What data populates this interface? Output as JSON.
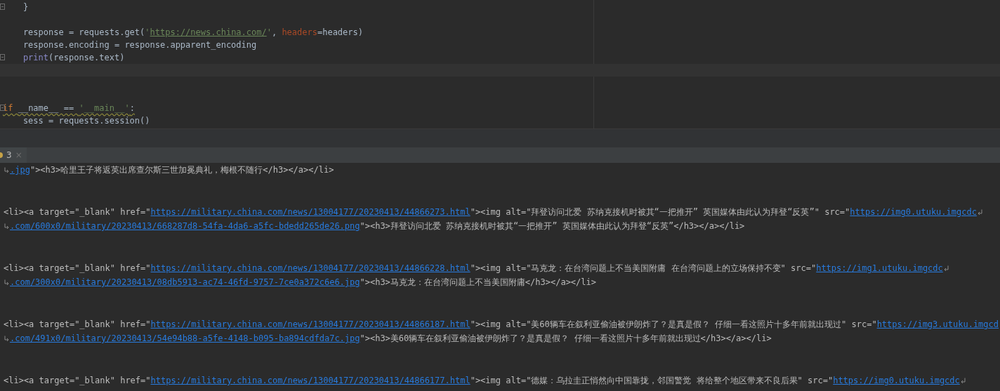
{
  "editor": {
    "lines": [
      {
        "kind": "code",
        "fold": true,
        "tokens": [
          {
            "kind": "plain",
            "text": "    }"
          }
        ]
      },
      {
        "kind": "blank"
      },
      {
        "kind": "code",
        "tokens": [
          {
            "kind": "plain",
            "text": "    response = requests.get("
          },
          {
            "kind": "string",
            "text": "'"
          },
          {
            "kind": "url",
            "text": "https://news.china.com/"
          },
          {
            "kind": "string",
            "text": "'"
          },
          {
            "kind": "plain",
            "text": ", "
          },
          {
            "kind": "param",
            "text": "headers"
          },
          {
            "kind": "plain",
            "text": "=headers)"
          }
        ]
      },
      {
        "kind": "code",
        "tokens": [
          {
            "kind": "plain",
            "text": "    response.encoding = response.apparent_encoding"
          }
        ]
      },
      {
        "kind": "code",
        "fold": true,
        "tokens": [
          {
            "kind": "builtin",
            "text": "    print"
          },
          {
            "kind": "plain",
            "text": "(response.text)"
          }
        ]
      },
      {
        "kind": "blank",
        "current": true
      },
      {
        "kind": "blank"
      },
      {
        "kind": "blank"
      },
      {
        "kind": "code",
        "fold": true,
        "warning": true,
        "tokens": [
          {
            "kind": "keyword",
            "text": "if "
          },
          {
            "kind": "plain",
            "text": "__name__ == "
          },
          {
            "kind": "string",
            "text": "'__main__'"
          },
          {
            "kind": "plain",
            "text": ":"
          }
        ]
      },
      {
        "kind": "code",
        "tokens": [
          {
            "kind": "plain",
            "text": "    sess = requests.session()"
          }
        ]
      }
    ]
  },
  "run_tabs": [
    {
      "label": "3",
      "close": "×",
      "selected": true
    }
  ],
  "console": {
    "records": [
      {
        "lines": [
          {
            "wrap_start": true,
            "segments": [
              {
                "kind": "link",
                "text": ".jpg"
              },
              {
                "kind": "text",
                "text": "\"><h3>哈里王子将返英出席查尔斯三世加冕典礼，梅根不随行</h3></a></li>"
              }
            ]
          }
        ]
      },
      {
        "lines": [
          {
            "wrap_end": true,
            "segments": [
              {
                "kind": "text",
                "text": "<li><a target=\"_blank\" href=\""
              },
              {
                "kind": "link",
                "text": "https://military.china.com/news/13004177/20230413/44866273.html"
              },
              {
                "kind": "text",
                "text": "\"><img alt=\"拜登访问北爱 苏纳克接机时被其“一把推开” 英国媒体由此认为拜登“反英”\" src=\""
              },
              {
                "kind": "link",
                "text": "https://img0.utuku.imgcdc"
              }
            ]
          },
          {
            "wrap_start": true,
            "segments": [
              {
                "kind": "link",
                "text": ".com/600x0/military/20230413/668287d8-54fa-4da6-a5fc-bdedd265de26.png"
              },
              {
                "kind": "text",
                "text": "\"><h3>拜登访问北爱 苏纳克接机时被其“一把推开” 英国媒体由此认为拜登“反英”</h3></a></li>"
              }
            ]
          }
        ]
      },
      {
        "lines": [
          {
            "wrap_end": true,
            "segments": [
              {
                "kind": "text",
                "text": "<li><a target=\"_blank\" href=\""
              },
              {
                "kind": "link",
                "text": "https://military.china.com/news/13004177/20230413/44866228.html"
              },
              {
                "kind": "text",
                "text": "\"><img alt=\"马克龙：在台湾问题上不当美国附庸 在台湾问题上的立场保持不变\" src=\""
              },
              {
                "kind": "link",
                "text": "https://img1.utuku.imgcdc"
              }
            ]
          },
          {
            "wrap_start": true,
            "segments": [
              {
                "kind": "link",
                "text": ".com/300x0/military/20230413/08db5913-ac74-46fd-9757-7ce0a372c6e6.jpg"
              },
              {
                "kind": "text",
                "text": "\"><h3>马克龙：在台湾问题上不当美国附庸</h3></a></li>"
              }
            ]
          }
        ]
      },
      {
        "lines": [
          {
            "segments": [
              {
                "kind": "text",
                "text": "<li><a target=\"_blank\" href=\""
              },
              {
                "kind": "link",
                "text": "https://military.china.com/news/13004177/20230413/44866187.html"
              },
              {
                "kind": "text",
                "text": "\"><img alt=\"美60辆车在叙利亚偷油被伊朗炸了？是真是假？ 仔细一看这照片十多年前就出现过\" src=\""
              },
              {
                "kind": "link",
                "text": "https://img3.utuku.imgcd"
              }
            ]
          },
          {
            "wrap_start": true,
            "segments": [
              {
                "kind": "link",
                "text": ".com/491x0/military/20230413/54e94b88-a5fe-4148-b095-ba894cdfda7c.jpg"
              },
              {
                "kind": "text",
                "text": "\"><h3>美60辆车在叙利亚偷油被伊朗炸了？是真是假？ 仔细一看这照片十多年前就出现过</h3></a></li>"
              }
            ]
          }
        ]
      },
      {
        "lines": [
          {
            "wrap_end": true,
            "segments": [
              {
                "kind": "text",
                "text": "<li><a target=\"_blank\" href=\""
              },
              {
                "kind": "link",
                "text": "https://military.china.com/news/13004177/20230413/44866177.html"
              },
              {
                "kind": "text",
                "text": "\"><img alt=\"德媒：乌拉圭正悄然向中国靠拢，邻国警觉 将给整个地区带来不良后果\" src=\""
              },
              {
                "kind": "link",
                "text": "https://img0.utuku.imgcdc"
              }
            ]
          }
        ]
      }
    ]
  }
}
